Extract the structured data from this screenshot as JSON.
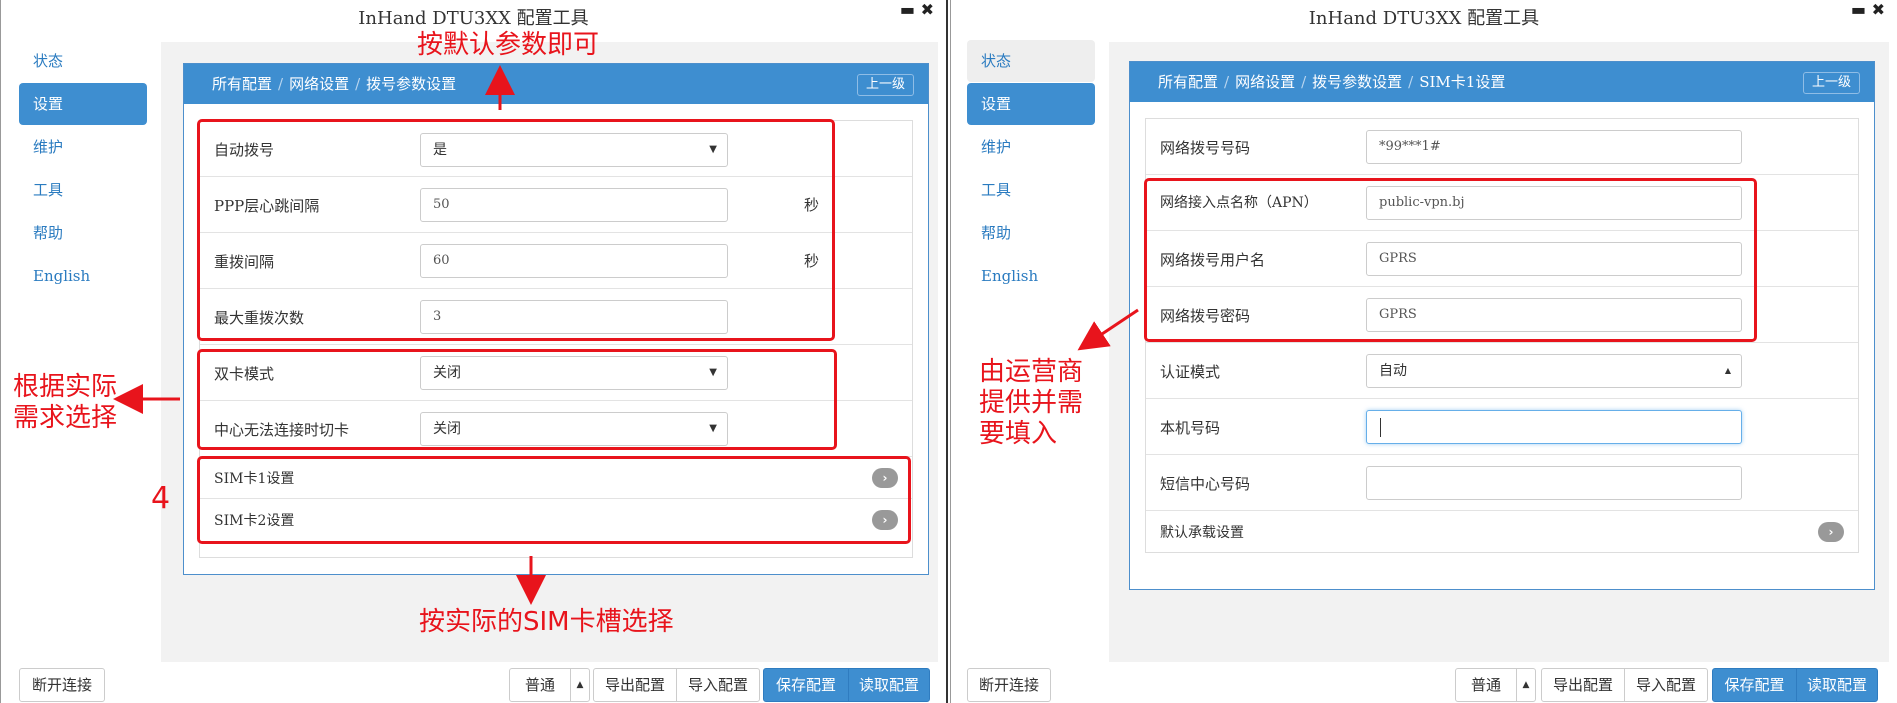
{
  "app": {
    "title": "InHand DTU3XX 配置工具",
    "win_controls": "▬ ✖"
  },
  "sidebar": {
    "items": [
      {
        "label": "状态"
      },
      {
        "label": "设置"
      },
      {
        "label": "维护"
      },
      {
        "label": "工具"
      },
      {
        "label": "帮助"
      },
      {
        "label": "English"
      }
    ]
  },
  "left": {
    "breadcrumb": [
      "所有配置",
      "网络设置",
      "拨号参数设置"
    ],
    "up_label": "上一级",
    "rows": [
      {
        "label": "自动拨号",
        "value": "是",
        "type": "select"
      },
      {
        "label": "PPP层心跳间隔",
        "value": "50",
        "unit": "秒",
        "type": "input"
      },
      {
        "label": "重拨间隔",
        "value": "60",
        "unit": "秒",
        "type": "input"
      },
      {
        "label": "最大重拨次数",
        "value": "3",
        "type": "input"
      },
      {
        "label": "双卡模式",
        "value": "关闭",
        "type": "select"
      },
      {
        "label": "中心无法连接时切卡",
        "value": "关闭",
        "type": "select"
      }
    ],
    "links": [
      {
        "label": "SIM卡1设置"
      },
      {
        "label": "SIM卡2设置"
      }
    ]
  },
  "right": {
    "breadcrumb": [
      "所有配置",
      "网络设置",
      "拨号参数设置",
      "SIM卡1设置"
    ],
    "up_label": "上一级",
    "rows": [
      {
        "label": "网络拨号号码",
        "value": "*99***1#",
        "type": "input"
      },
      {
        "label": "网络接入点名称（APN）",
        "value": "public-vpn.bj",
        "type": "input"
      },
      {
        "label": "网络拨号用户名",
        "value": "GPRS",
        "type": "input"
      },
      {
        "label": "网络拨号密码",
        "value": "GPRS",
        "type": "input"
      },
      {
        "label": "认证模式",
        "value": "自动",
        "type": "select"
      },
      {
        "label": "本机号码",
        "value": "",
        "type": "input"
      },
      {
        "label": "短信中心号码",
        "value": "",
        "type": "input"
      }
    ],
    "links": [
      {
        "label": "默认承载设置"
      }
    ]
  },
  "footer": {
    "disconnect": "断开连接",
    "mode": "普通",
    "export": "导出配置",
    "import": "导入配置",
    "save": "保存配置",
    "read": "读取配置"
  },
  "annotations": {
    "default_params": "按默认参数即可",
    "choose_by_need": "根据实际需求选择",
    "step_number": "4",
    "choose_sim_slot": "按实际的SIM卡槽选择",
    "fill_by_operator": "由运营商提供并需要填入"
  },
  "colors": {
    "accent": "#3e8ed0",
    "annotation_red": "#e8141c",
    "link": "#2a7bc0"
  }
}
